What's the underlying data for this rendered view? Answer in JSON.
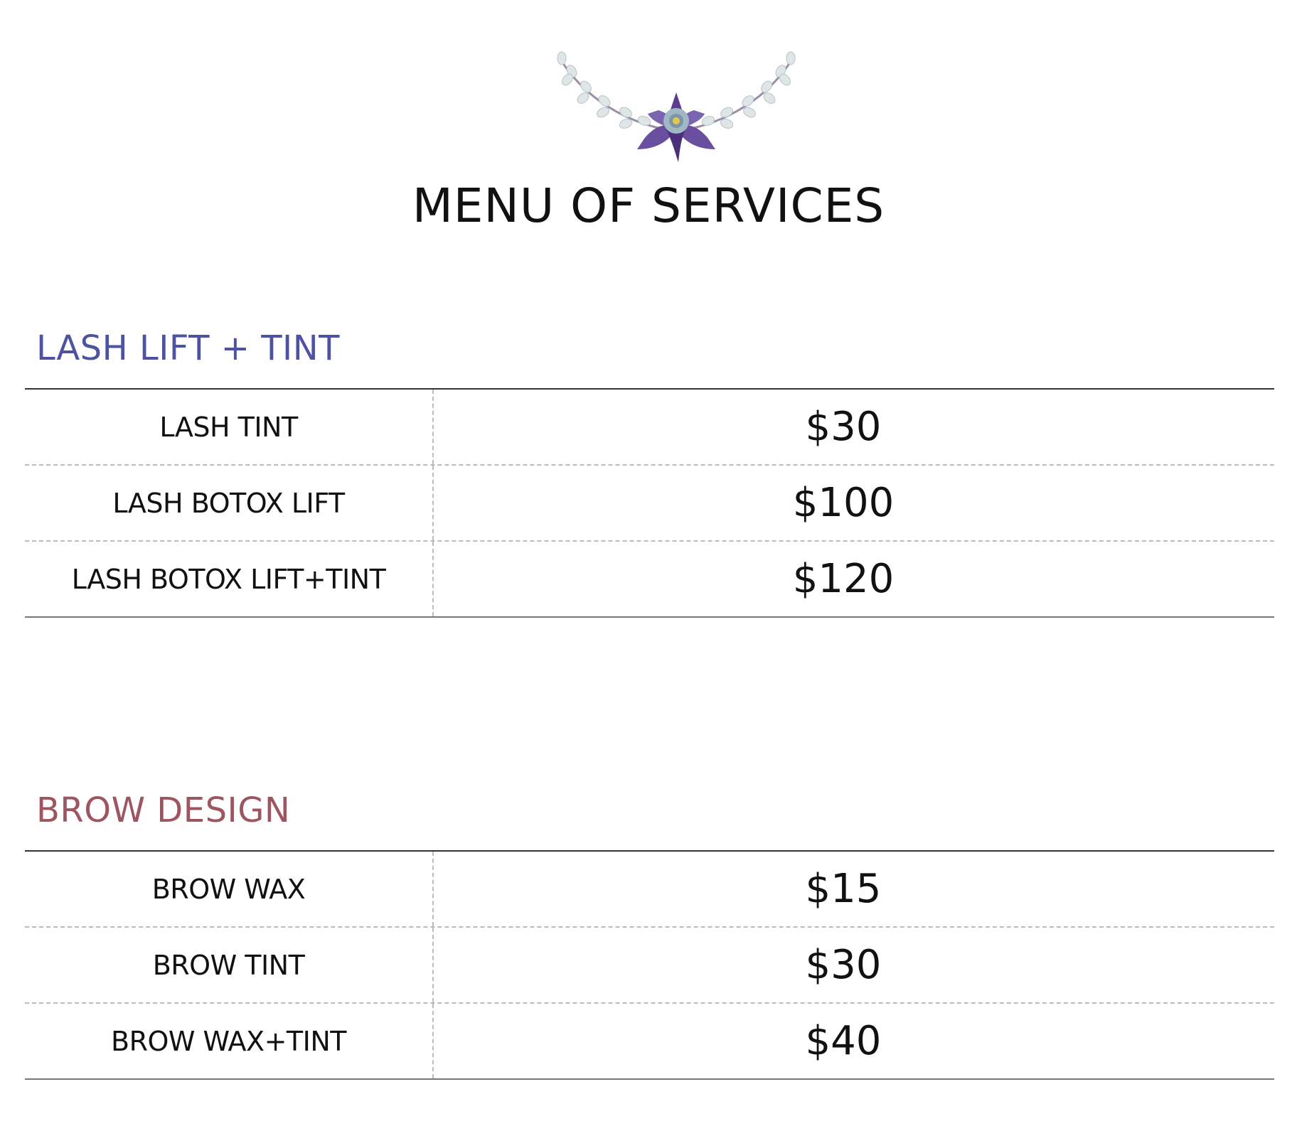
{
  "page": {
    "title": "MENU OF SERVICES",
    "ornament_icon": "floral-wreath-icon"
  },
  "colors": {
    "lash_heading": "#4e52a3",
    "brow_heading": "#9e5560",
    "text": "#111111",
    "rule": "#333333",
    "dashed": "#bbbbbb",
    "flower": "#6a4fa0"
  },
  "sections": [
    {
      "heading": "LASH LIFT + TINT",
      "services": [
        {
          "name": "LASH TINT",
          "price": "$30"
        },
        {
          "name": "LASH BOTOX LIFT",
          "price": "$100"
        },
        {
          "name": "LASH BOTOX LIFT+TINT",
          "price": "$120"
        }
      ]
    },
    {
      "heading": "BROW DESIGN",
      "services": [
        {
          "name": "BROW WAX",
          "price": "$15"
        },
        {
          "name": "BROW TINT",
          "price": "$30"
        },
        {
          "name": "BROW WAX+TINT",
          "price": "$40"
        }
      ]
    }
  ]
}
